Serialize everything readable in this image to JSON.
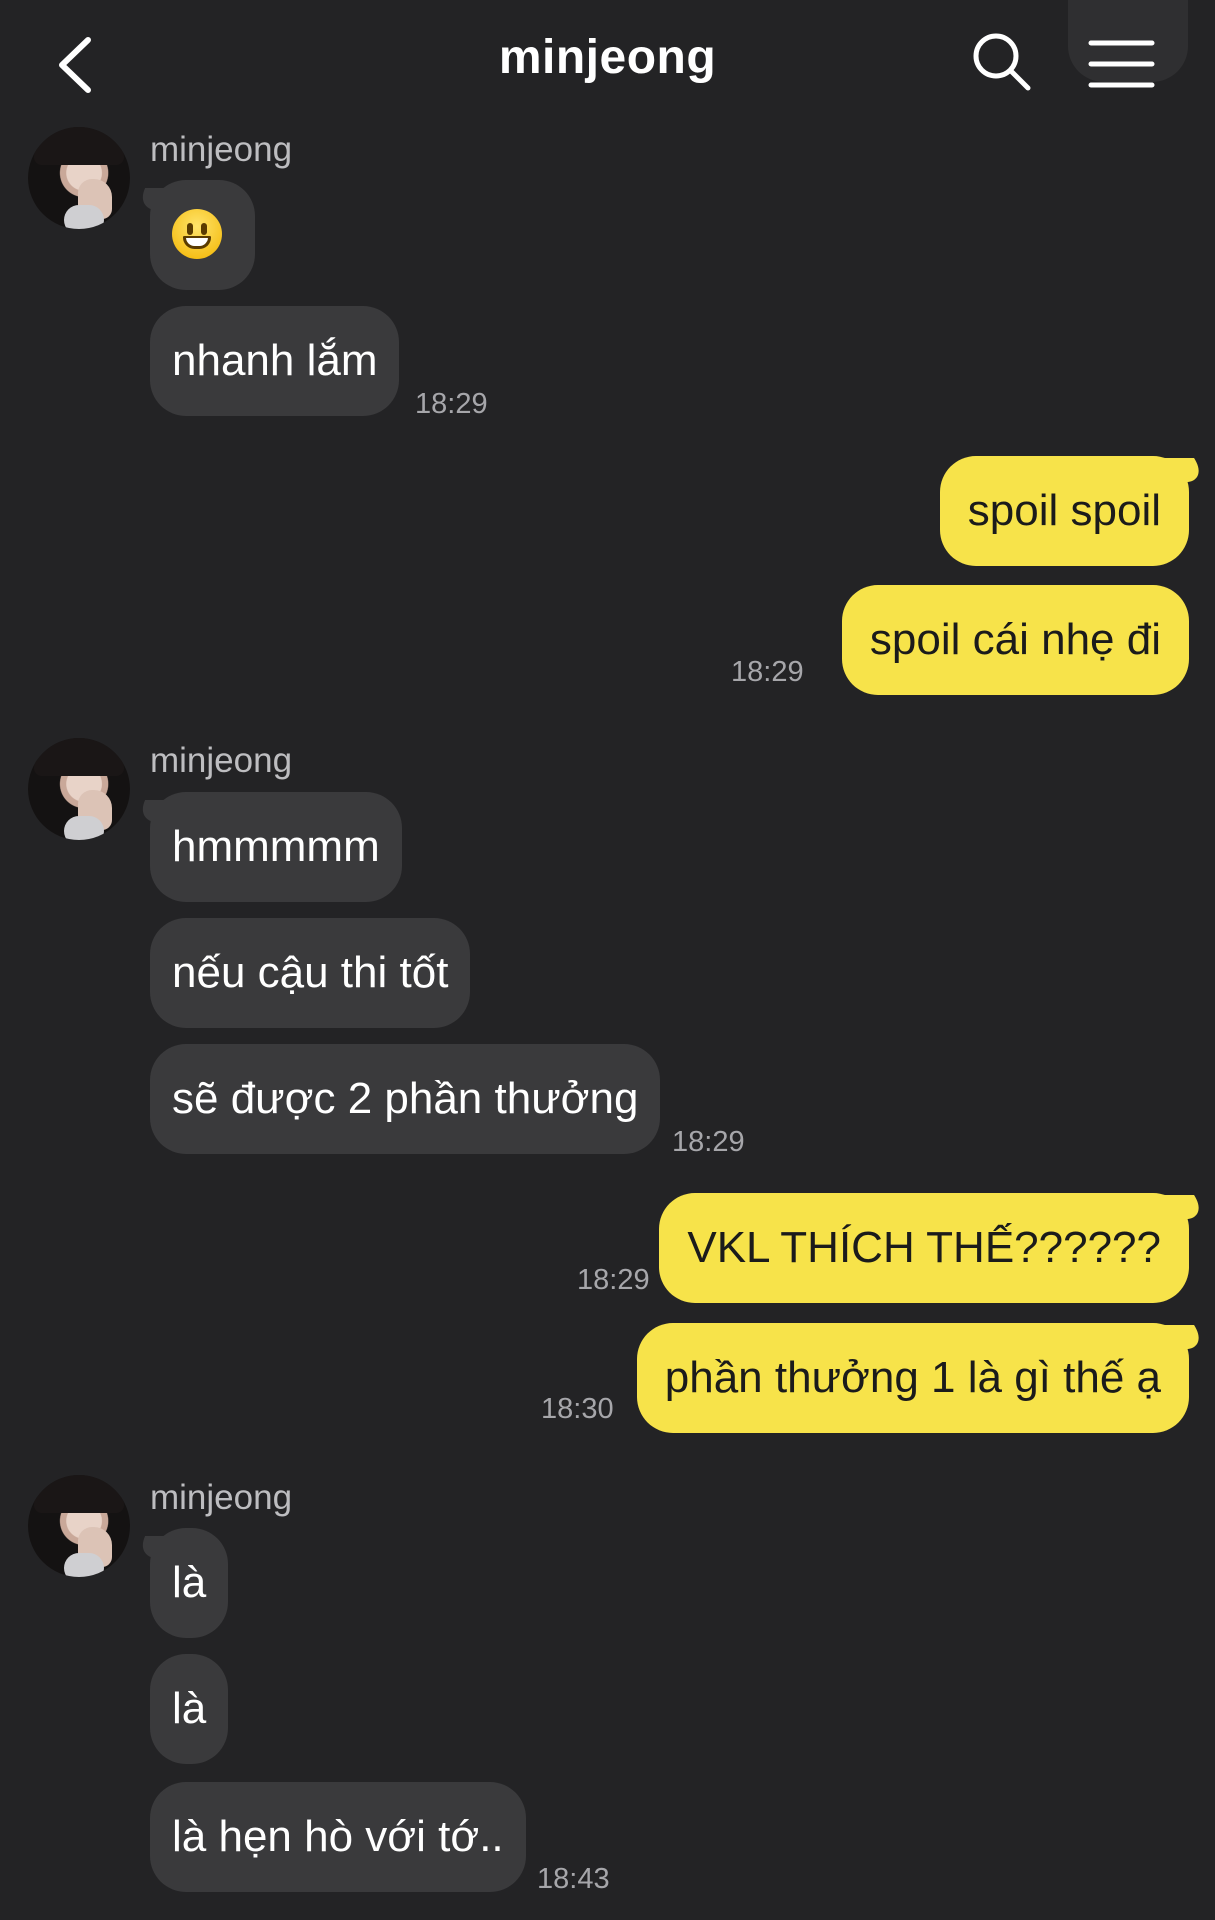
{
  "header": {
    "title": "minjeong",
    "back_icon": "chevron-left-icon",
    "search_icon": "search-icon",
    "menu_icon": "hamburger-menu-icon"
  },
  "colors": {
    "background": "#232325",
    "incoming_bubble": "#3a3a3c",
    "outgoing_bubble": "#f7e34a",
    "timestamp": "#a6a6aa"
  },
  "messages": [
    {
      "sender": "minjeong",
      "direction": "incoming",
      "items": [
        {
          "type": "emoji",
          "icon": "grinning-face-emoji"
        },
        {
          "text": "nhanh lắm",
          "time": "18:29"
        }
      ]
    },
    {
      "direction": "outgoing",
      "items": [
        {
          "text": "spoil spoil"
        },
        {
          "text": "spoil cái nhẹ đi",
          "time": "18:29"
        }
      ]
    },
    {
      "sender": "minjeong",
      "direction": "incoming",
      "items": [
        {
          "text": "hmmmmm"
        },
        {
          "text": "nếu cậu thi tốt"
        },
        {
          "text": "sẽ được 2 phần thưởng",
          "time": "18:29"
        }
      ]
    },
    {
      "direction": "outgoing",
      "items": [
        {
          "text": "VKL THÍCH THẾ??????",
          "time": "18:29"
        },
        {
          "text": "phần thưởng 1 là gì thế ạ",
          "time": "18:30"
        }
      ]
    },
    {
      "sender": "minjeong",
      "direction": "incoming",
      "items": [
        {
          "text": "là"
        },
        {
          "text": "là"
        },
        {
          "text": "là hẹn hò với tớ..",
          "time": "18:43"
        }
      ]
    }
  ]
}
